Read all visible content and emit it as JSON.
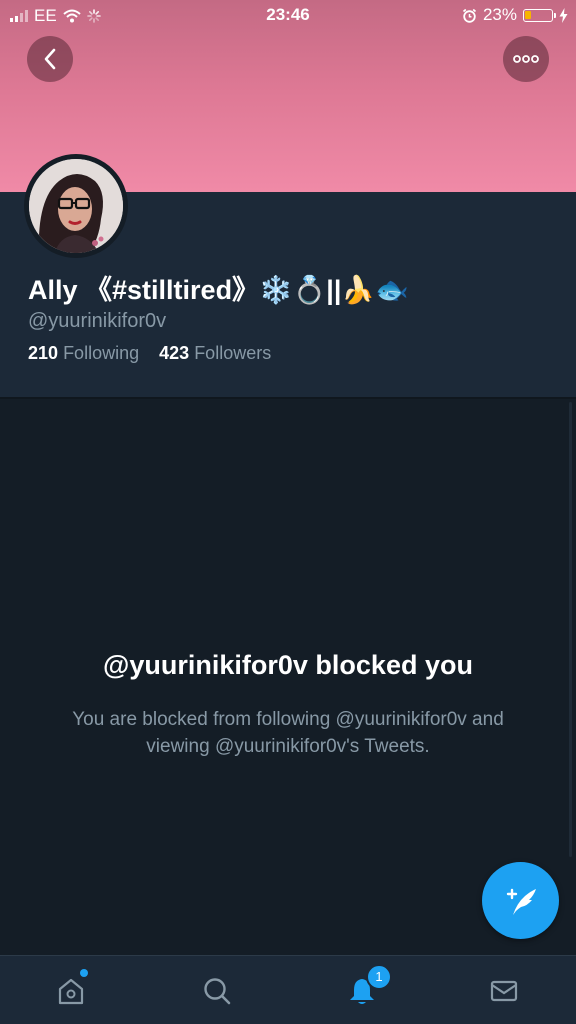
{
  "status_bar": {
    "carrier": "EE",
    "time": "23:46",
    "battery_percent": "23%"
  },
  "profile": {
    "name": "Ally 《#stilltired》❄️💍||🍌🐟",
    "handle": "@yuurinikifor0v",
    "following_count": "210",
    "following_label": "Following",
    "followers_count": "423",
    "followers_label": "Followers"
  },
  "blocked": {
    "title": "@yuurinikifor0v blocked you",
    "description": "You are blocked from following @yuurinikifor0v and viewing @yuurinikifor0v's Tweets."
  },
  "tabbar": {
    "notifications_badge": "1"
  },
  "colors": {
    "accent": "#1da1f2",
    "banner": "#e07a96",
    "background": "#141d26",
    "panel": "#1c2938",
    "muted_text": "#8899a6"
  },
  "icons": {
    "back": "chevron-left-icon",
    "more": "more-options-icon",
    "compose": "compose-tweet-icon",
    "home": "home-icon",
    "search": "search-icon",
    "notifications": "bell-icon",
    "messages": "mail-icon"
  }
}
